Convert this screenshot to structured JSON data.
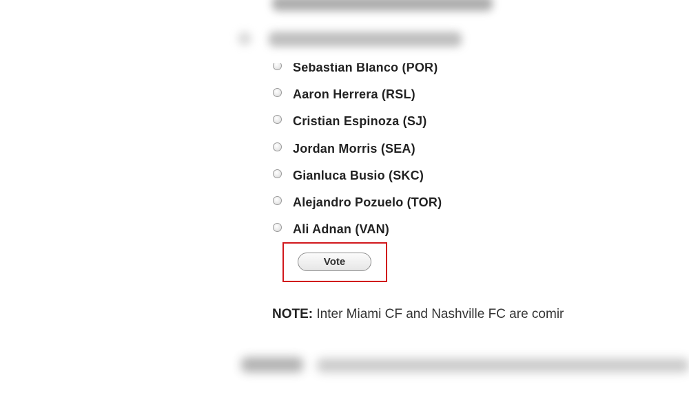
{
  "poll": {
    "options": [
      {
        "label": "Sebastian Blanco (POR)"
      },
      {
        "label": "Aaron Herrera (RSL)"
      },
      {
        "label": "Cristian Espinoza (SJ)"
      },
      {
        "label": "Jordan Morris (SEA)"
      },
      {
        "label": "Gianluca Busio (SKC)"
      },
      {
        "label": "Alejandro Pozuelo (TOR)"
      },
      {
        "label": "Ali Adnan (VAN)"
      }
    ],
    "vote_label": "Vote"
  },
  "note": {
    "label": "NOTE:",
    "text": " Inter Miami CF and Nashville FC are comir"
  },
  "colors": {
    "highlight_border": "#d1171c",
    "text": "#222222"
  }
}
